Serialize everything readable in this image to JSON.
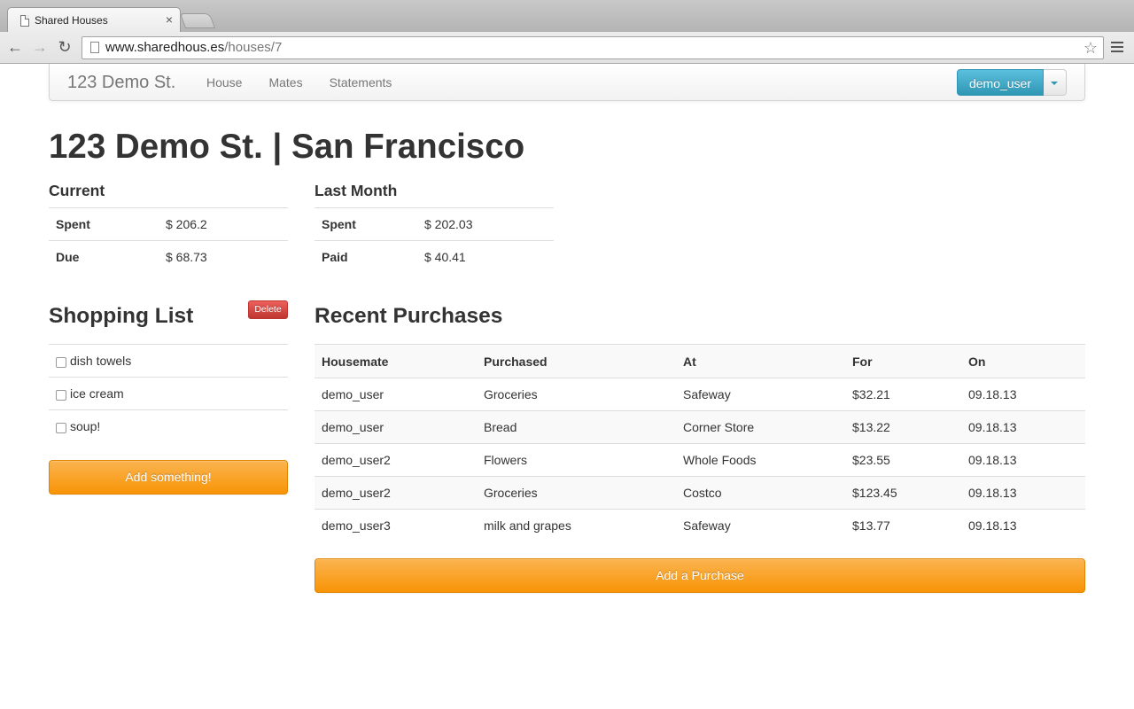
{
  "browser": {
    "tab_title": "Shared Houses",
    "tab_close": "×",
    "url_host": "www.sharedhous.es",
    "url_path": "/houses/7"
  },
  "navbar": {
    "brand": "123 Demo St.",
    "links": [
      "House",
      "Mates",
      "Statements"
    ],
    "user": "demo_user"
  },
  "page_title": "123 Demo St. | San Francisco",
  "current": {
    "heading": "Current",
    "rows": [
      {
        "label": "Spent",
        "value": "$ 206.2"
      },
      {
        "label": "Due",
        "value": "$ 68.73"
      }
    ]
  },
  "last_month": {
    "heading": "Last Month",
    "rows": [
      {
        "label": "Spent",
        "value": "$ 202.03"
      },
      {
        "label": "Paid",
        "value": "$ 40.41"
      }
    ]
  },
  "shopping": {
    "heading": "Shopping List",
    "delete_label": "Delete",
    "items": [
      "dish towels",
      "ice cream",
      "soup!"
    ],
    "add_label": "Add something!"
  },
  "purchases": {
    "heading": "Recent Purchases",
    "columns": [
      "Housemate",
      "Purchased",
      "At",
      "For",
      "On"
    ],
    "rows": [
      [
        "demo_user",
        "Groceries",
        "Safeway",
        "$32.21",
        "09.18.13"
      ],
      [
        "demo_user",
        "Bread",
        "Corner Store",
        "$13.22",
        "09.18.13"
      ],
      [
        "demo_user2",
        "Flowers",
        "Whole Foods",
        "$23.55",
        "09.18.13"
      ],
      [
        "demo_user2",
        "Groceries",
        "Costco",
        "$123.45",
        "09.18.13"
      ],
      [
        "demo_user3",
        "milk and grapes",
        "Safeway",
        "$13.77",
        "09.18.13"
      ]
    ],
    "add_label": "Add a Purchase"
  },
  "colors": {
    "primary_info": "#2f96b4",
    "warning": "#f89406",
    "danger": "#bd362f"
  },
  "icons": [
    "document-icon",
    "close-icon",
    "back-arrow-icon",
    "forward-arrow-icon",
    "reload-icon",
    "star-icon",
    "menu-icon",
    "caret-down-icon"
  ]
}
